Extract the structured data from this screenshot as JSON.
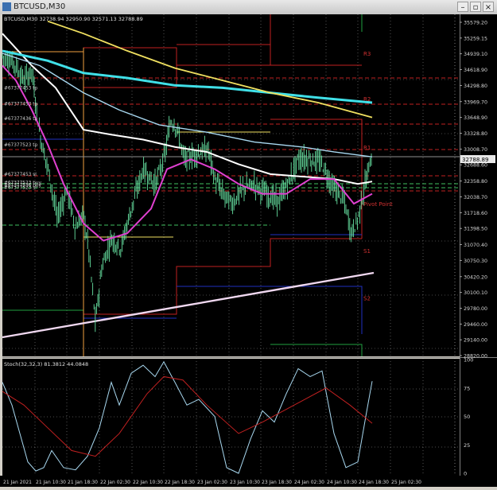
{
  "window": {
    "title": "BTCUSD,M30",
    "buttons": {
      "minimize": "–",
      "restore": "▫",
      "close": "×"
    }
  },
  "main_panel": {
    "info": "BTCUSD,M30 32738.94 32950.90 32571.13 32788.89",
    "price_axis": [
      "35579.20",
      "35259.15",
      "34939.10",
      "34618.90",
      "34298.80",
      "33969.70",
      "33648.90",
      "33328.80",
      "33008.70",
      "32688.60",
      "32358.80",
      "32038.70",
      "31718.60",
      "31398.50",
      "31070.40",
      "30750.30",
      "30420.20",
      "30100.10",
      "29780.00",
      "29460.00",
      "29140.00",
      "28820.00"
    ],
    "current_price": "32788.89",
    "order_labels": [
      {
        "text": "#67377453 tp",
        "price": 34200
      },
      {
        "text": "#67377453 tp",
        "price": 33880
      },
      {
        "text": "#67377436 tp",
        "price": 33580
      },
      {
        "text": "#67377523 tp",
        "price": 33050
      },
      {
        "text": "#67377453 sl",
        "price": 32450
      },
      {
        "text": "#67377523 buy",
        "price": 32280
      },
      {
        "text": "#67377536 buy",
        "price": 32230
      },
      {
        "text": "#67377523 sl",
        "price": 32180
      }
    ],
    "pivot_labels": [
      {
        "text": "R3",
        "price": 34950
      },
      {
        "text": "R2",
        "price": 34030
      },
      {
        "text": "R1",
        "price": 33050
      },
      {
        "text": "Pivot Point",
        "price": 31900
      },
      {
        "text": "S1",
        "price": 30950
      },
      {
        "text": "S2",
        "price": 29990
      }
    ]
  },
  "stoch_panel": {
    "label": "Stoch(32,32,3) 81.3812 44.0848",
    "levels": [
      "100",
      "75",
      "50",
      "25",
      "0"
    ]
  },
  "time_axis": [
    "21 Jan 2021",
    "21 Jan 10:30",
    "21 Jan 18:30",
    "22 Jan 02:30",
    "22 Jan 10:30",
    "22 Jan 18:30",
    "23 Jan 02:30",
    "23 Jan 10:30",
    "23 Jan 18:30",
    "24 Jan 02:30",
    "24 Jan 10:30",
    "24 Jan 18:30",
    "25 Jan 02:30"
  ],
  "colors": {
    "background": "#000000",
    "candles": "#66e0a0",
    "ma_white": "#ffffff",
    "ma_lightblue": "#a8d8f0",
    "ma_cyan": "#40e0e8",
    "ma_yellow": "#f0e060",
    "ma_magenta": "#e040d0",
    "trend_line": "#f0d8f0",
    "pivot_red": "#c02020",
    "pivot_blue": "#2030c0",
    "pivot_green": "#20a040",
    "stoch_main": "#a8d8f0",
    "stoch_signal": "#c02020",
    "grid": "#ffffff"
  }
}
